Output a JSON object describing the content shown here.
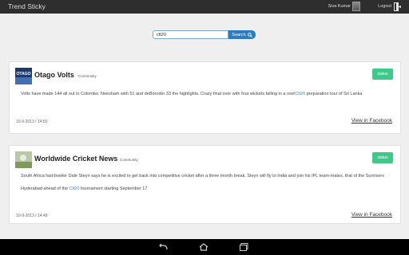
{
  "app": {
    "title": "Trend Sticky"
  },
  "header": {
    "user_name": "Siva Kumar",
    "logout_label": "Logout"
  },
  "search": {
    "value": "cft20",
    "button_label": "Search"
  },
  "feed": [
    {
      "source": "Otago Volts",
      "logo_text": "OTAGO",
      "category": "Community",
      "status_label": "status",
      "text_before": "Volts have made 144 all out in Colombo. Neesham with 51 and deBoorder 33 the highlights. Crazy final over with four wickets falling in a row!",
      "tag": "Clt20",
      "text_after": " preparation tour of Sri Lanka",
      "date": "10-9-2013 / 14:50",
      "link_label": "View in Facebook"
    },
    {
      "source": "Worldwide Cricket News",
      "category": "Community",
      "status_label": "status",
      "text_line1": "South Africa fast-bowler Dale Steyn says he is excited to get back into competitive cricket after a three month break. Steyn will fly to India and join his IPL team-mates, that of the Sunrisers",
      "text_before": "Hyderabad ahead of the ",
      "tag": "Clt20",
      "text_after": " tournament starting September 17",
      "date": "10-9-2013 / 14:48",
      "link_label": "View in Facebook"
    }
  ],
  "colors": {
    "topbar": "#2e2e2e",
    "accent": "#2d7cc1",
    "status": "#3ec98a",
    "hashtag": "#3a86c9"
  },
  "icons": {
    "logout": "logout-icon",
    "search": "search-icon",
    "back": "back-icon",
    "home": "home-icon",
    "recents": "recents-icon"
  }
}
